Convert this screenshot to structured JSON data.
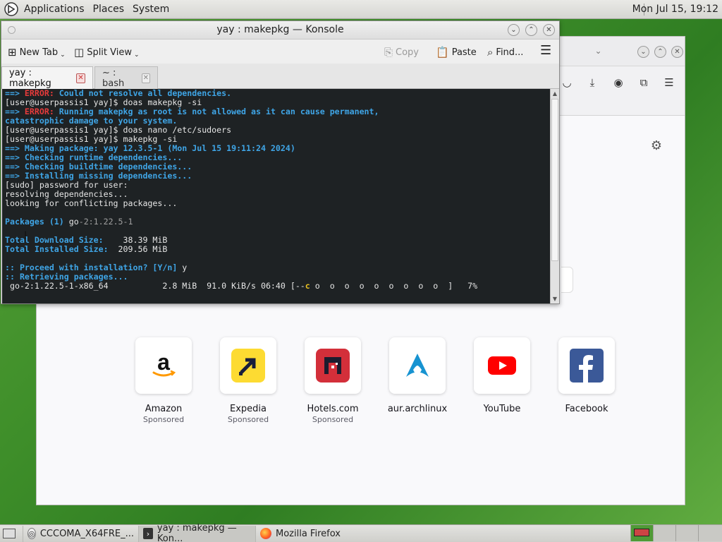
{
  "panel": {
    "menus": [
      "Applications",
      "Places",
      "System"
    ],
    "clock": "Mon Jul 15, 19:12"
  },
  "konsole": {
    "title": "yay : makepkg — Konsole",
    "toolbar": {
      "new_tab": "New Tab",
      "split_view": "Split View",
      "copy": "Copy",
      "paste": "Paste",
      "find": "Find..."
    },
    "tabs": [
      {
        "label": "yay : makepkg",
        "active": true
      },
      {
        "label": "~ : bash",
        "active": false
      }
    ],
    "lines": [
      [
        {
          "t": "==> ",
          "c": "c-blue"
        },
        {
          "t": "ERROR: ",
          "c": "c-red"
        },
        {
          "t": "Could not resolve all dependencies.",
          "c": "c-blue"
        }
      ],
      [
        {
          "t": "[user@userpassis1 yay]$ doas makepkg -si",
          "c": ""
        }
      ],
      [
        {
          "t": "==> ",
          "c": "c-blue"
        },
        {
          "t": "ERROR: ",
          "c": "c-red"
        },
        {
          "t": "Running makepkg as root is not allowed as it can cause permanent,",
          "c": "c-blue"
        }
      ],
      [
        {
          "t": "catastrophic damage to your system.",
          "c": "c-blue"
        }
      ],
      [
        {
          "t": "[user@userpassis1 yay]$ doas nano /etc/sudoers",
          "c": ""
        }
      ],
      [
        {
          "t": "[user@userpassis1 yay]$ makepkg -si",
          "c": ""
        }
      ],
      [
        {
          "t": "==> ",
          "c": "c-blue"
        },
        {
          "t": "Making package: yay 12.3.5-1 (Mon Jul 15 19:11:24 2024)",
          "c": "c-blue"
        }
      ],
      [
        {
          "t": "==> ",
          "c": "c-blue"
        },
        {
          "t": "Checking runtime dependencies...",
          "c": "c-blue"
        }
      ],
      [
        {
          "t": "==> ",
          "c": "c-blue"
        },
        {
          "t": "Checking buildtime dependencies...",
          "c": "c-blue"
        }
      ],
      [
        {
          "t": "==> ",
          "c": "c-blue"
        },
        {
          "t": "Installing missing dependencies...",
          "c": "c-blue"
        }
      ],
      [
        {
          "t": "[sudo] password for user:",
          "c": ""
        }
      ],
      [
        {
          "t": "resolving dependencies...",
          "c": ""
        }
      ],
      [
        {
          "t": "looking for conflicting packages...",
          "c": ""
        }
      ],
      [
        {
          "t": "",
          "c": ""
        }
      ],
      [
        {
          "t": "Packages (1) ",
          "c": "c-blue"
        },
        {
          "t": "go",
          "c": ""
        },
        {
          "t": "-2:1.22.5-1",
          "c": "c-dim"
        }
      ],
      [
        {
          "t": "",
          "c": ""
        }
      ],
      [
        {
          "t": "Total Download Size:  ",
          "c": "c-blue"
        },
        {
          "t": "  38.39 MiB",
          "c": ""
        }
      ],
      [
        {
          "t": "Total Installed Size: ",
          "c": "c-blue"
        },
        {
          "t": " 209.56 MiB",
          "c": ""
        }
      ],
      [
        {
          "t": "",
          "c": ""
        }
      ],
      [
        {
          "t": ":: Proceed with installation? [Y/n] ",
          "c": "c-blue"
        },
        {
          "t": "y",
          "c": ""
        }
      ],
      [
        {
          "t": ":: Retrieving packages...",
          "c": "c-blue"
        }
      ],
      [
        {
          "t": " go-2:1.22.5-1-x86_64           2.8 MiB  91.0 KiB/s 06:40 [--",
          "c": ""
        },
        {
          "t": "c",
          "c": "c-yel"
        },
        {
          "t": " o  o  o  o  o  o  o  o  o  ]   7%",
          "c": ""
        }
      ]
    ]
  },
  "firefox": {
    "shortcuts": [
      {
        "name": "Amazon",
        "sponsored": "Sponsored",
        "icon": "amazon-logo"
      },
      {
        "name": "Expedia",
        "sponsored": "Sponsored",
        "icon": "expedia-logo"
      },
      {
        "name": "Hotels.com",
        "sponsored": "Sponsored",
        "icon": "hotels-logo"
      },
      {
        "name": "aur.archlinux",
        "sponsored": "",
        "icon": "archlinux-logo"
      },
      {
        "name": "YouTube",
        "sponsored": "",
        "icon": "youtube-logo"
      },
      {
        "name": "Facebook",
        "sponsored": "",
        "icon": "facebook-logo"
      }
    ]
  },
  "taskbar": {
    "items": [
      {
        "label": "CCCOMA_X64FRE_...",
        "icon": "disc-icon"
      },
      {
        "label": "yay : makepkg — Kon...",
        "icon": "terminal-icon"
      },
      {
        "label": "Mozilla Firefox",
        "icon": "firefox-icon"
      }
    ]
  },
  "colors": {
    "terminal_bg": "#1e2224",
    "term_blue": "#3fa5e6",
    "term_red": "#e83b3b",
    "desktop_green": "#3f8f2a"
  }
}
